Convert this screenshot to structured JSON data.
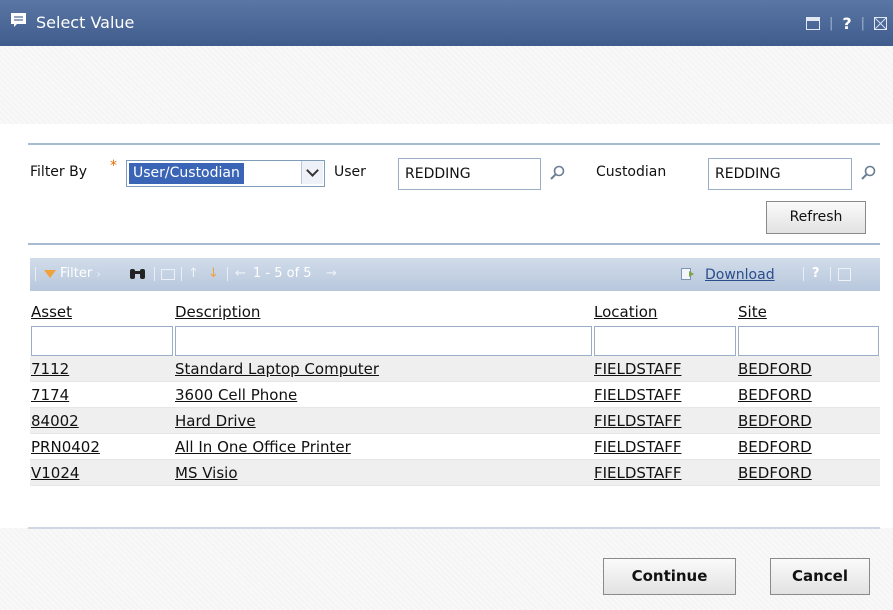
{
  "window": {
    "title": "Select Value"
  },
  "filter": {
    "label": "Filter By",
    "required_mark": "*",
    "selected": "User/Custodian",
    "user_label": "User",
    "user_value": "REDDING",
    "custodian_label": "Custodian",
    "custodian_value": "REDDING",
    "refresh_label": "Refresh"
  },
  "toolbar": {
    "filter_label": "Filter",
    "paging": "1 - 5 of 5",
    "download_label": "Download",
    "help": "?"
  },
  "table": {
    "columns": [
      "Asset",
      "Description",
      "Location",
      "Site"
    ],
    "rows": [
      [
        "7112",
        "Standard Laptop Computer",
        "FIELDSTAFF",
        "BEDFORD"
      ],
      [
        "7174",
        "3600 Cell Phone",
        "FIELDSTAFF",
        "BEDFORD"
      ],
      [
        "84002",
        "Hard Drive",
        "FIELDSTAFF",
        "BEDFORD"
      ],
      [
        "PRN0402",
        "All In One Office Printer",
        "FIELDSTAFF",
        "BEDFORD"
      ],
      [
        "V1024",
        "MS Visio",
        "FIELDSTAFF",
        "BEDFORD"
      ]
    ]
  },
  "actions": {
    "continue_label": "Continue",
    "cancel_label": "Cancel"
  },
  "colors": {
    "title_bar": "#4a6796",
    "toolbar": "#c4d2e4",
    "selection": "#3a64b6",
    "required": "#e06c00"
  }
}
